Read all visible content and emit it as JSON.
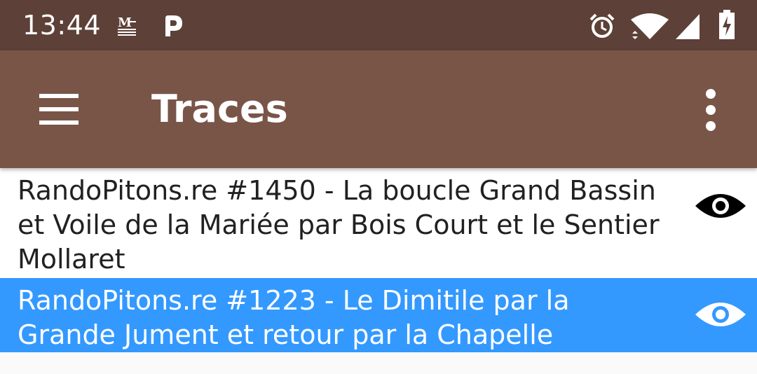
{
  "status_bar": {
    "time": "13:44",
    "color": "#5d4037",
    "icons": [
      "email-icon",
      "p-app-icon",
      "alarm-icon",
      "wifi-icon",
      "signal-icon",
      "battery-charging-icon"
    ],
    "mail_glyph": "M"
  },
  "toolbar": {
    "title": "Traces",
    "color": "#795548",
    "menu_icon": "hamburger-menu-icon",
    "overflow_icon": "more-vert-icon"
  },
  "traces": [
    {
      "title": "RandoPitons.re #1450 - La boucle Grand Bassin et Voile de la Mariée par Bois Court  et le Sentier Mollaret",
      "selected": false,
      "icon": "eye-icon"
    },
    {
      "title": "RandoPitons.re #1223 - Le Dimitile par la Grande Jument et retour par la Chapelle",
      "selected": true,
      "icon": "eye-icon"
    }
  ],
  "colors": {
    "selected_row": "#3399ff",
    "row_background": "#ffffff",
    "list_background": "#fafafa"
  }
}
